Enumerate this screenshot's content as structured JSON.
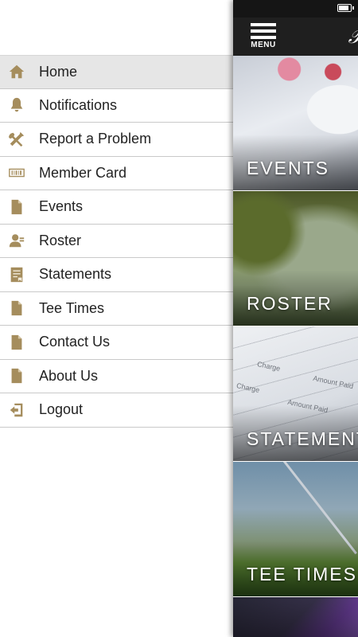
{
  "drawer": {
    "items": [
      {
        "label": "Home",
        "icon": "home-icon",
        "active": true
      },
      {
        "label": "Notifications",
        "icon": "bell-icon"
      },
      {
        "label": "Report a Problem",
        "icon": "tools-icon"
      },
      {
        "label": "Member Card",
        "icon": "barcode-icon"
      },
      {
        "label": "Events",
        "icon": "document-icon"
      },
      {
        "label": "Roster",
        "icon": "person-icon"
      },
      {
        "label": "Statements",
        "icon": "statement-icon"
      },
      {
        "label": "Tee Times",
        "icon": "document-icon"
      },
      {
        "label": "Contact Us",
        "icon": "document-icon"
      },
      {
        "label": "About Us",
        "icon": "document-icon"
      },
      {
        "label": "Logout",
        "icon": "logout-icon"
      }
    ]
  },
  "header": {
    "menu_label": "MENU"
  },
  "tiles": [
    {
      "label": "EVENTS"
    },
    {
      "label": "ROSTER"
    },
    {
      "label": "STATEMENTS"
    },
    {
      "label": "TEE TIMES"
    }
  ],
  "statement_image_text": {
    "charge_1": "Charge",
    "amount_paid_1": "Amount Paid",
    "charge_2": "Charge",
    "amount_paid_2": "Amount Paid"
  },
  "colors": {
    "icon_gold": "#a58d5d",
    "active_row": "#e6e6e6",
    "header_bg": "#1f1f1f"
  }
}
